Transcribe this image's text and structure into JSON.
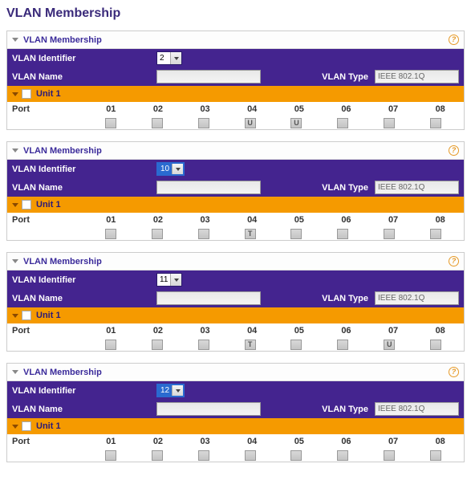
{
  "page_title": "VLAN Membership",
  "help_glyph": "?",
  "labels": {
    "vlan_identifier": "VLAN Identifier",
    "vlan_name": "VLAN Name",
    "vlan_type": "VLAN Type",
    "port": "Port"
  },
  "port_headers": [
    "01",
    "02",
    "03",
    "04",
    "05",
    "06",
    "07",
    "08"
  ],
  "panels": [
    {
      "title": "VLAN Membership",
      "identifier": "2",
      "identifier_highlight": false,
      "name_value": "",
      "type_value": "IEEE 802.1Q",
      "unit_label": "Unit 1",
      "states": [
        "",
        "",
        "",
        "U",
        "U",
        "",
        "",
        ""
      ]
    },
    {
      "title": "VLAN Membership",
      "identifier": "10",
      "identifier_highlight": true,
      "name_value": "",
      "type_value": "IEEE 802.1Q",
      "unit_label": "Unit 1",
      "states": [
        "",
        "",
        "",
        "T",
        "",
        "",
        "",
        ""
      ]
    },
    {
      "title": "VLAN Membership",
      "identifier": "11",
      "identifier_highlight": false,
      "name_value": "",
      "type_value": "IEEE 802.1Q",
      "unit_label": "Unit 1",
      "states": [
        "",
        "",
        "",
        "T",
        "",
        "",
        "U",
        ""
      ]
    },
    {
      "title": "VLAN Membership",
      "identifier": "12",
      "identifier_highlight": true,
      "name_value": "",
      "type_value": "IEEE 802.1Q",
      "unit_label": "Unit 1",
      "states": [
        "",
        "",
        "",
        "",
        "",
        "",
        "",
        ""
      ]
    }
  ]
}
